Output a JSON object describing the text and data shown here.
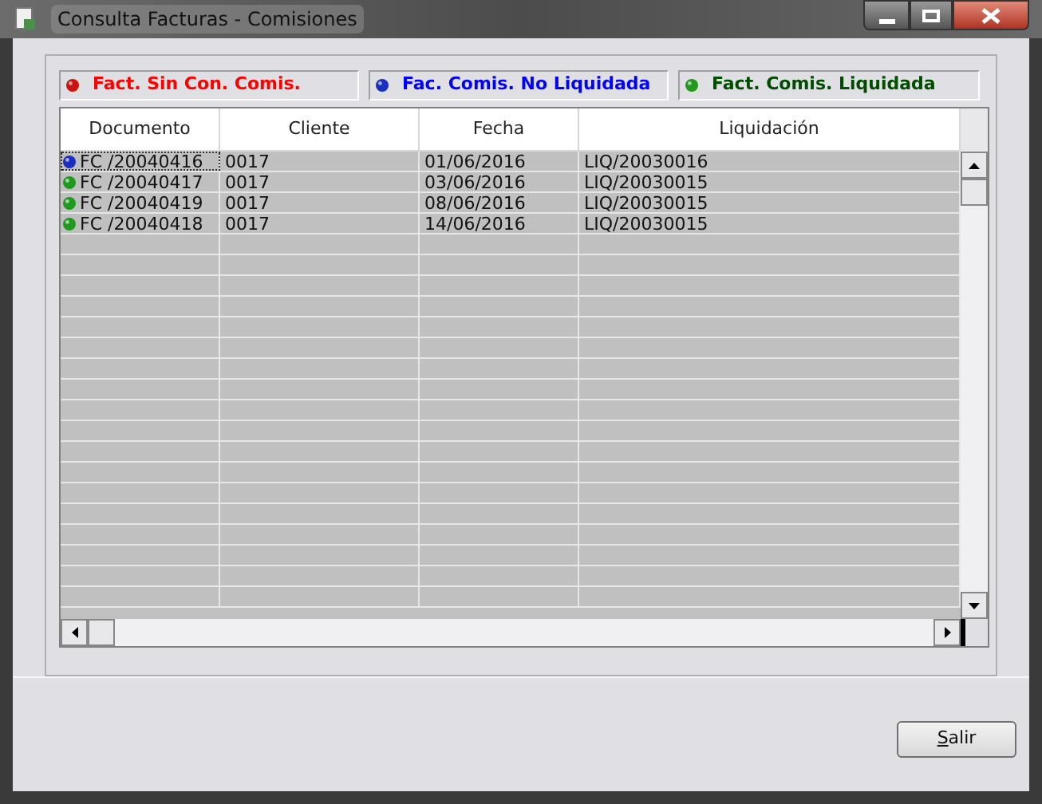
{
  "window": {
    "title": "Consulta Facturas - Comisiones"
  },
  "legend": [
    {
      "label": "Fact. Sin Con. Comis.",
      "color": "#cc1111"
    },
    {
      "label": "Fac. Comis. No Liquidada",
      "color": "#1a2fbf"
    },
    {
      "label": "Fact. Comis. Liquidada",
      "color": "#1f9a1f"
    }
  ],
  "table": {
    "columns": [
      "Documento",
      "Cliente",
      "Fecha",
      "Liquidación"
    ],
    "rows": [
      {
        "color": "#1a2fbf",
        "selected": true,
        "cells": [
          "FC /20040416",
          "0017",
          "01/06/2016",
          "LIQ/20030016"
        ]
      },
      {
        "color": "#1f9a1f",
        "selected": false,
        "cells": [
          "FC /20040417",
          "0017",
          "03/06/2016",
          "LIQ/20030015"
        ]
      },
      {
        "color": "#1f9a1f",
        "selected": false,
        "cells": [
          "FC /20040419",
          "0017",
          "08/06/2016",
          "LIQ/20030015"
        ]
      },
      {
        "color": "#1f9a1f",
        "selected": false,
        "cells": [
          "FC /20040418",
          "0017",
          "14/06/2016",
          "LIQ/20030015"
        ]
      }
    ]
  },
  "buttons": [
    "Salir"
  ]
}
